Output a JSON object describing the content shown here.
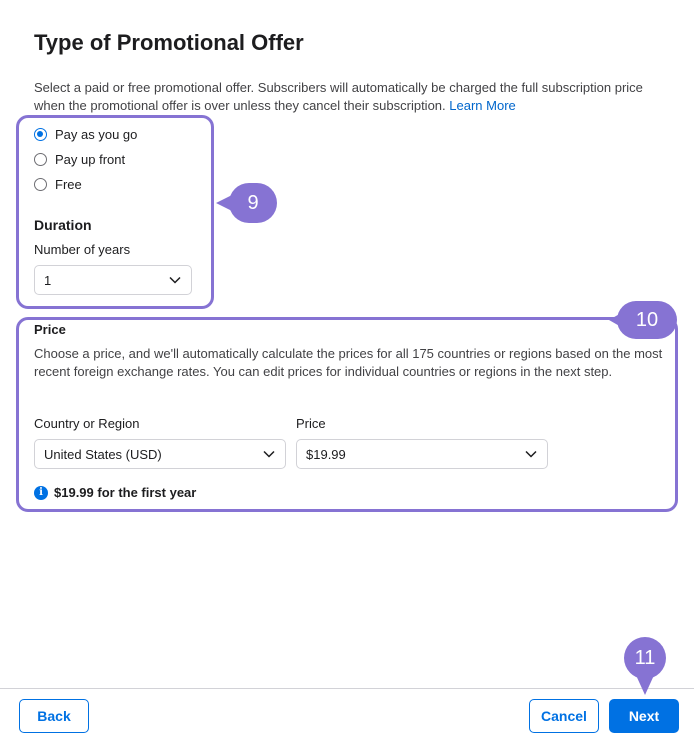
{
  "header": {
    "title": "Type of Promotional Offer",
    "description": "Select a paid or free promotional offer. Subscribers will automatically be charged the full subscription price when the promotional offer is over unless they cancel their subscription.",
    "learn_more": "Learn More"
  },
  "offer_types": [
    {
      "label": "Pay as you go",
      "selected": true
    },
    {
      "label": "Pay up front",
      "selected": false
    },
    {
      "label": "Free",
      "selected": false
    }
  ],
  "duration": {
    "title": "Duration",
    "label": "Number of years",
    "value": "1"
  },
  "price_section": {
    "title": "Price",
    "description": "Choose a price, and we'll automatically calculate the prices for all 175 countries or regions based on the most recent foreign exchange rates. You can edit prices for individual countries or regions in the next step.",
    "country_label": "Country or Region",
    "country_value": "United States (USD)",
    "price_label": "Price",
    "price_value": "$19.99",
    "summary": "$19.99 for the first year"
  },
  "callouts": {
    "step_a": "9",
    "step_b": "10",
    "step_c": "11",
    "color": "#8673d3"
  },
  "footer": {
    "back": "Back",
    "cancel": "Cancel",
    "next": "Next"
  },
  "colors": {
    "accent": "#0071e3",
    "link": "#0066cc"
  }
}
